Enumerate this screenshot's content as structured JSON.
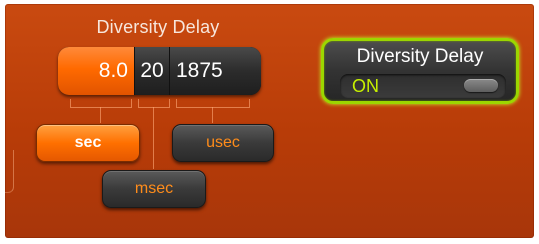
{
  "diversity_delay": {
    "title": "Diversity Delay",
    "readout": {
      "sec_value": "8.0",
      "msec_value": "20",
      "usec_value": "1875"
    },
    "units": {
      "sec_label": "sec",
      "msec_label": "msec",
      "usec_label": "usec",
      "selected": "sec"
    }
  },
  "toggle": {
    "title": "Diversity Delay",
    "state_label": "ON",
    "state": "on"
  },
  "colors": {
    "panel_background": "#b83c08",
    "accent_orange": "#ff7000",
    "toggle_border": "#9cd600",
    "state_text": "#c6f000",
    "unit_text": "#ff8c1a"
  },
  "icons": {
    "toggle_knob": "toggle-knob-icon"
  }
}
